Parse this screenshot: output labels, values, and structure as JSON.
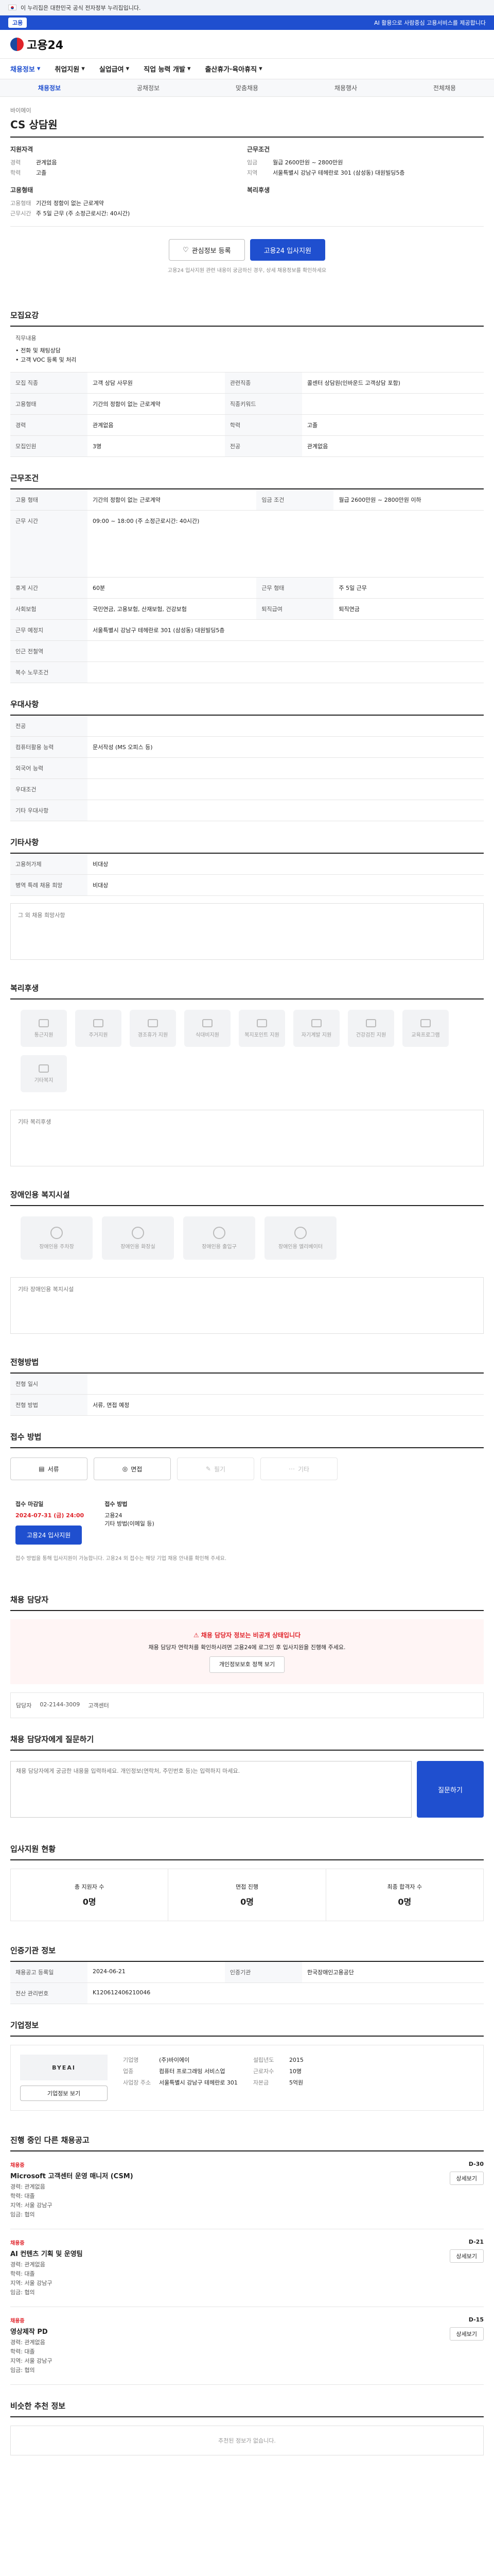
{
  "gov_bar": {
    "text": "이 누리집은 대한민국 공식 전자정부 누리집입니다."
  },
  "top_strip": {
    "pill": "고용",
    "right": "AI 활용으로 사람중심 고용서비스를 제공합니다"
  },
  "logo": {
    "text": "고용24"
  },
  "gnb": [
    "채용정보",
    "취업지원",
    "실업급여",
    "직업 능력 개발",
    "출산휴가·육아휴직"
  ],
  "sub_tabs": [
    "채용정보",
    "공채정보",
    "맞춤채용",
    "채용행사",
    "전체채용"
  ],
  "job": {
    "company": "바이에이",
    "title": "CS 상담원",
    "apply_qual_title": "지원자격",
    "work_cond_title": "근무조건",
    "career_k": "경력",
    "career_v": "관계없음",
    "edu_k": "학력",
    "edu_v": "고졸",
    "pay_k": "임금",
    "pay_v": "월급 2600만원 ~ 2800만원",
    "loc_k": "지역",
    "loc_v": "서울특별시 강남구 테헤란로 301 (삼성동) 대원빌딩5층",
    "type_title": "고용형태",
    "type_k": "고용형태",
    "type_v": "기간의 정함이 없는 근로계약",
    "hours_k": "근무시간",
    "hours_v": "주 5일 근무 (주 소정근로시간: 40시간)",
    "welfare_title": "복리후생"
  },
  "actions": {
    "scrap": "관심정보 등록",
    "apply": "고용24 입사지원"
  },
  "note": "고용24 입사지원 관련 내용이 궁금하신 경우, 상세 채용정보를 확인하세요",
  "sections": {
    "duty": "모집요강",
    "condition": "근무조건",
    "preference": "우대사항",
    "other": "기타사항",
    "welfare": "복리후생",
    "barrier": "장애인용 복지시설",
    "process": "전형방법",
    "apply": "접수 방법",
    "contact": "채용 담당자",
    "inquiry": "채용 담당자에게 질문하기",
    "stats": "입사지원 현황",
    "certified": "인증기관 정보",
    "company": "기업정보",
    "other_jobs": "진행 중인 다른 채용공고",
    "similar": "비슷한 추천 정보"
  },
  "duty": {
    "desc_label": "직무내용",
    "desc": "• 전화 및 채팅상담\n• 고객 VOC 등록 및 처리",
    "rows": [
      {
        "k": "모집 직종",
        "v": "고객 상담 사무원"
      },
      {
        "k": "관련직종",
        "v": "콜센터 상담원(인바운드 고객상담 포함)"
      },
      {
        "k": "고용형태",
        "v": "기간의 정함이 없는 근로계약"
      },
      {
        "k": "직종키워드",
        "v": ""
      },
      {
        "k": "경력",
        "v": "관계없음"
      },
      {
        "k": "학력",
        "v": "고졸"
      },
      {
        "k": "모집인원",
        "v": "3명"
      },
      {
        "k": "전공",
        "v": "관계없음"
      }
    ]
  },
  "condition": {
    "rows": [
      {
        "k": "고용 형태",
        "v": "기간의 정함이 없는 근로계약"
      },
      {
        "k": "임금 조건",
        "v": "월급 2600만원 ~ 2800만원 이하"
      },
      {
        "k": "근무 시간",
        "v": "09:00 ~ 18:00 (주 소정근로시간: 40시간)"
      },
      {
        "k": "휴게 시간",
        "v": "60분"
      },
      {
        "k": "근무 형태",
        "v": "주 5일 근무"
      },
      {
        "k": "사회보험",
        "v": "국민연금, 고용보험, 산재보험, 건강보험"
      },
      {
        "k": "퇴직급여",
        "v": "퇴직연금"
      },
      {
        "k": "근무 예정지",
        "v": "서울특별시 강남구 테헤란로 301 (삼성동) 대원빌딩5층"
      },
      {
        "k": "인근 전철역",
        "v": ""
      },
      {
        "k": "복수 노무조건",
        "v": ""
      }
    ]
  },
  "preference": {
    "rows": [
      {
        "k": "전공",
        "v": ""
      },
      {
        "k": "컴퓨터활용 능력",
        "v": "문서작성 (MS 오피스 등)"
      },
      {
        "k": "외국어 능력",
        "v": ""
      },
      {
        "k": "우대조건",
        "v": ""
      },
      {
        "k": "기타 우대사항",
        "v": ""
      }
    ]
  },
  "other": {
    "rows": [
      {
        "k": "고용허가제",
        "v": "비대상"
      },
      {
        "k": "병역 특례 채용 희망",
        "v": "비대상"
      }
    ],
    "box": "그 외 채용 희망사항"
  },
  "welfare_items": [
    "통근지원",
    "주거지원",
    "경조휴가 지원",
    "식대비지원",
    "복지포인트 지원",
    "자기계발 지원",
    "건강검진 지원",
    "교육프로그램",
    "기타복지"
  ],
  "welfare_box": "기타 복리후생",
  "barrier_items": [
    "장애인용 주차장",
    "장애인용 화장실",
    "장애인용 출입구",
    "장애인용 엘리베이터"
  ],
  "barrier_box": "기타 장애인용 복지시설",
  "process": {
    "rows": [
      {
        "k": "전형 일시",
        "v": ""
      },
      {
        "k": "전형 방법",
        "v": "서류, 면접 예정"
      }
    ],
    "methods": [
      {
        "label": "서류",
        "on": true
      },
      {
        "label": "면접",
        "on": true
      },
      {
        "label": "필기",
        "on": false
      },
      {
        "label": "기타",
        "on": false
      }
    ]
  },
  "apply": {
    "deadline_label": "접수 마감일",
    "deadline": "2024-07-31 (금) 24:00",
    "type_label": "접수 방법",
    "type": "고용24\n기타 방법(이메일 등)",
    "btn": "고용24 입사지원",
    "note": "접수 방법을 통해 입사지원이 가능합니다. 고용24 외 접수는 해당 기업 채용 안내를 확인해 주세요."
  },
  "contact": {
    "title": "채용 담당자 정보는 비공개 상태입니다",
    "body": "채용 담당자 연락처를 확인하시려면 고용24에 로그인 후 입사지원을 진행해 주세요.",
    "btn": "개인정보보호 정책 보기",
    "manager_label": "담당자",
    "manager_date": "02-2144-3009",
    "manager_tel": "고객센터"
  },
  "inquiry": {
    "placeholder": "채용 담당자에게 궁금한 내용을 입력하세요. 개인정보(연락처, 주민번호 등)는 입력하지 마세요.",
    "send": "질문하기"
  },
  "stats": [
    {
      "k": "총 지원자 수",
      "v": "0명"
    },
    {
      "k": "면접 진행",
      "v": "0명"
    },
    {
      "k": "최종 합격자 수",
      "v": "0명"
    }
  ],
  "certified": {
    "rows": [
      {
        "k": "채용공고 등록일",
        "v": "2024-06-21"
      },
      {
        "k": "인증기관",
        "v": "한국장애인고용공단"
      },
      {
        "k": "전산 관리번호",
        "v": "K120612406210046"
      }
    ]
  },
  "company": {
    "logo_text": "BYEAI",
    "name": "바이에이",
    "rows": [
      {
        "k": "기업명",
        "v": "(주)바이에이"
      },
      {
        "k": "업종",
        "v": "컴퓨터 프로그래밍 서비스업"
      },
      {
        "k": "사업장 주소",
        "v": "서울특별시 강남구 테헤란로 301"
      },
      {
        "k": "설립년도",
        "v": "2015"
      },
      {
        "k": "근로자수",
        "v": "10명"
      },
      {
        "k": "자본금",
        "v": "5억원"
      }
    ],
    "btn": "기업정보 보기"
  },
  "other_jobs": [
    {
      "tag": "채용중",
      "title": "Microsoft 고객센터 운영 매니저 (CSM)",
      "meta": "경력: 관계없음\n학력: 대졸\n지역: 서울 강남구\n임금: 협의",
      "dl": "D-30"
    },
    {
      "tag": "채용중",
      "title": "AI 컨텐츠 기획 및 운영팀",
      "meta": "경력: 관계없음\n학력: 대졸\n지역: 서울 강남구\n임금: 협의",
      "dl": "D-21"
    },
    {
      "tag": "채용중",
      "title": "영상제작 PD",
      "meta": "경력: 관계없음\n학력: 대졸\n지역: 서울 강남구\n임금: 협의",
      "dl": "D-15"
    }
  ],
  "other_jobs_detail": "상세보기",
  "similar_empty": "추천된 정보가 없습니다."
}
